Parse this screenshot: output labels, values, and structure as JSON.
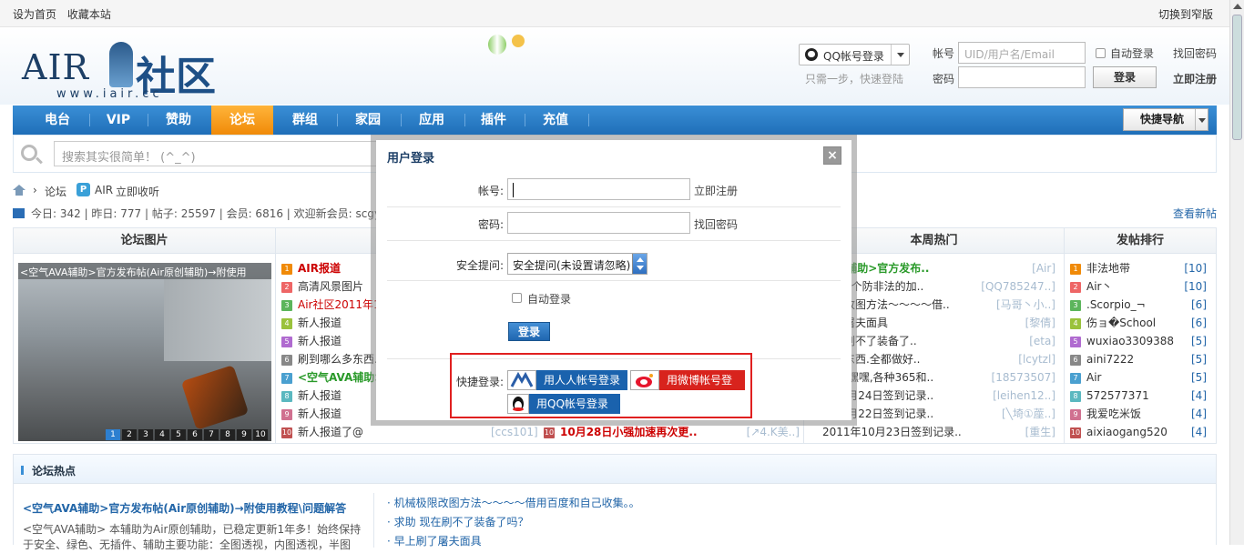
{
  "topbar": {
    "set_home": "设为首页",
    "bookmark": "收藏本站",
    "switch_width": "切换到窄版"
  },
  "logo": {
    "text_air": "AIR",
    "text_community": "社区",
    "url": "www.iair.cc"
  },
  "qq_login": {
    "label": "QQ帐号登录",
    "hint": "只需一步，快速登陆"
  },
  "login_form": {
    "account_label": "帐号",
    "account_placeholder": "UID/用户名/Email",
    "auto_login": "自动登录",
    "find_password": "找回密码",
    "password_label": "密码",
    "login_button": "登录",
    "register": "立即注册"
  },
  "nav": {
    "items": [
      "电台",
      "VIP",
      "赞助",
      "论坛",
      "群组",
      "家园",
      "应用",
      "插件",
      "充值"
    ],
    "active": "论坛",
    "quick_nav": "快捷导航"
  },
  "search": {
    "placeholder": "搜索其实很简单！ (^_^)"
  },
  "breadcrumb": {
    "forum": "论坛",
    "air": "AIR",
    "listen": "立即收听"
  },
  "stats": {
    "text": "今日: 342 | 昨日: 777 | 帖子: 25597 | 会员: 6816 | 欢迎新会员: scgyy",
    "new_topics": "查看新帖"
  },
  "board": {
    "col1_title": "论坛图片",
    "col3_title": "本周热门",
    "col4_title": "发帖排行",
    "slide_caption": "<空气AVA辅助>官方发布帖(Air原创辅助)→附使用",
    "slide_pages": [
      "1",
      "2",
      "3",
      "4",
      "5",
      "6",
      "7",
      "8",
      "9",
      "10"
    ],
    "col2_items": [
      {
        "text": "AIR报道",
        "color": "#c00"
      },
      {
        "text": "高清风景图片",
        "color": "#333"
      },
      {
        "text": "Air社区2011年10",
        "color": "#c00"
      },
      {
        "text": "新人报道",
        "color": "#333"
      },
      {
        "text": "新人报道",
        "color": "#333"
      },
      {
        "text": "刷到哪么多东西.全",
        "color": "#333"
      },
      {
        "text": "<空气AVA辅助>",
        "color": "#2a9a2a"
      },
      {
        "text": "新人报道",
        "color": "#333"
      },
      {
        "text": "新人报道",
        "color": "#333"
      },
      {
        "text": "新人报道了@",
        "color": "#333"
      }
    ],
    "col2_last_author": "[ccs101]",
    "col3_mid_last": "10月28日小强加速再次更..",
    "col3_mid_last_author": "[↗4.K美..]",
    "col3_items": [
      {
        "text": "AVA辅助>官方发布..",
        "author": "[Air]",
        "color": "#2a9a2a"
      },
      {
        "text": "5号发个防非法的加..",
        "author": "[QQ785247..]",
        "color": "#333"
      },
      {
        "text": "极限改图方法～～～～借..",
        "author": "[马哥丶小..]",
        "color": "#333"
      },
      {
        "text": "刷了屠夫面具",
        "author": "[黎倩]",
        "color": "#333"
      },
      {
        "text": "现在刷不了装备了..",
        "author": "[eta]",
        "color": "#333"
      },
      {
        "text": "么多东西.全都做好..",
        "author": "[lcytzl]",
        "color": "#333"
      },
      {
        "text": "一下,嘿嘿,各种365和..",
        "author": "[18573507]",
        "color": "#333"
      },
      {
        "text": "年10月24日签到记录..",
        "author": "[leihen12..]",
        "color": "#333"
      },
      {
        "text": "年10月22日签到记录..",
        "author": "[╲埼①蓙..]",
        "color": "#333"
      },
      {
        "text": "2011年10月23日签到记录..",
        "author": "[重生]",
        "color": "#333"
      }
    ],
    "col4_items": [
      {
        "name": "非法地带",
        "count": "[10]"
      },
      {
        "name": "Air丶",
        "count": "[10]"
      },
      {
        "name": ".Scorpio_¬",
        "count": "[6]"
      },
      {
        "name": "伤ョ�School",
        "count": "[6]"
      },
      {
        "name": "wuxiao3309388",
        "count": "[5]"
      },
      {
        "name": "aini7222",
        "count": "[5]"
      },
      {
        "name": "Air",
        "count": "[5]"
      },
      {
        "name": "572577371",
        "count": "[4]"
      },
      {
        "name": "我爱吃米饭",
        "count": "[4]"
      },
      {
        "name": "aixiaogang520",
        "count": "[4]"
      }
    ]
  },
  "hot": {
    "title": "论坛热点",
    "headline": "<空气AVA辅助>官方发布帖(Air原创辅助)→附使用教程\\问题解答",
    "desc": "<空气AVA辅助> 本辅助为Air原创辅助，已稳定更新1年多！始终保持于安全、绿色、无插件、辅助主要功能：全图透视，内图透视，半图",
    "right_items": [
      "· 机械极限改图方法～～～～借用百度和自己收集。。",
      "· 求助 现在刷不了装备了吗？",
      "· 早上刷了屠夫面具"
    ]
  },
  "modal": {
    "title": "用户登录",
    "close": "×",
    "account_label": "帐号:",
    "register_link": "立即注册",
    "password_label": "密码:",
    "find_password_link": "找回密码",
    "security_label": "安全提问:",
    "security_value": "安全提问(未设置请忽略)",
    "auto_login": "自动登录",
    "login_button": "登录",
    "quick_login_label": "快捷登录:",
    "renren_login": "用人人帐号登录",
    "weibo_login": "用微博帐号登录",
    "qq_login": "用QQ帐号登录"
  }
}
